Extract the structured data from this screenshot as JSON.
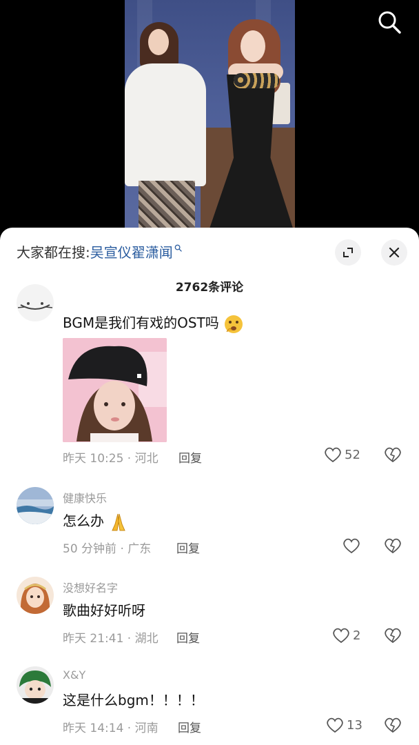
{
  "video": {
    "search_icon": "search-icon"
  },
  "sheet": {
    "search_prefix": "大家都在搜:",
    "search_term": "吴宣仪翟潇闻",
    "comment_count": "2762条评论"
  },
  "comments": [
    {
      "username": "",
      "text": "BGM是我们有戏的OST吗",
      "emoji": "thinking-face",
      "has_image": true,
      "time": "昨天 10:25",
      "location": "河北",
      "meta": "昨天 10:25 · 河北",
      "reply": "回复",
      "likes": "52"
    },
    {
      "username": "健康快乐",
      "text": "怎么办",
      "emoji": "folded-hands",
      "time": "50 分钟前",
      "location": "广东",
      "meta": "50 分钟前 · 广东",
      "reply": "回复",
      "likes": ""
    },
    {
      "username": "没想好名字",
      "text": "歌曲好好听呀",
      "time": "昨天 21:41",
      "location": "湖北",
      "meta": "昨天 21:41 · 湖北",
      "reply": "回复",
      "likes": "2"
    },
    {
      "username": "X&Y",
      "text": "这是什么bgm！！！！",
      "time": "昨天 14:14",
      "location": "河南",
      "meta": "昨天 14:14 · 河南",
      "reply": "回复",
      "likes": "13"
    }
  ],
  "colors": {
    "link": "#2a5c9f",
    "muted": "#9a9a9a",
    "sheet_bg": "#ffffff"
  }
}
